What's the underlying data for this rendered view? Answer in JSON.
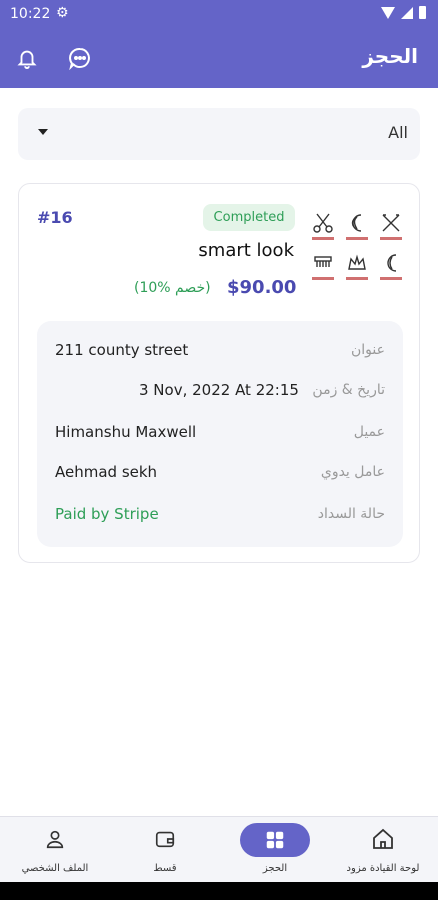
{
  "status_bar": {
    "time": "10:22"
  },
  "header": {
    "title": "الحجز"
  },
  "filter": {
    "selected": "All"
  },
  "booking": {
    "id": "#16",
    "status": "Completed",
    "salon_name": "smart look",
    "price": "$90.00",
    "discount": "(10% خصم)",
    "details": [
      {
        "label": "عنوان",
        "value": "211 county street"
      },
      {
        "label": "تاريخ & زمن",
        "value": "3 Nov, 2022 At 22:15"
      },
      {
        "label": "عميل",
        "value": "Himanshu Maxwell"
      },
      {
        "label": "عامل يدوي",
        "value": "Aehmad sekh"
      },
      {
        "label": "حالة السداد",
        "value": "Paid by Stripe"
      }
    ]
  },
  "bottom_nav": {
    "items": [
      {
        "label": "الملف الشخصي",
        "icon": "profile-icon"
      },
      {
        "label": "قسط",
        "icon": "wallet-icon"
      },
      {
        "label": "الحجز",
        "icon": "booking-icon"
      },
      {
        "label": "لوحة القيادة مزود",
        "icon": "home-icon"
      }
    ]
  },
  "colors": {
    "primary": "#6464c8",
    "accent": "#4a4ab0",
    "success": "#2e9e57"
  }
}
